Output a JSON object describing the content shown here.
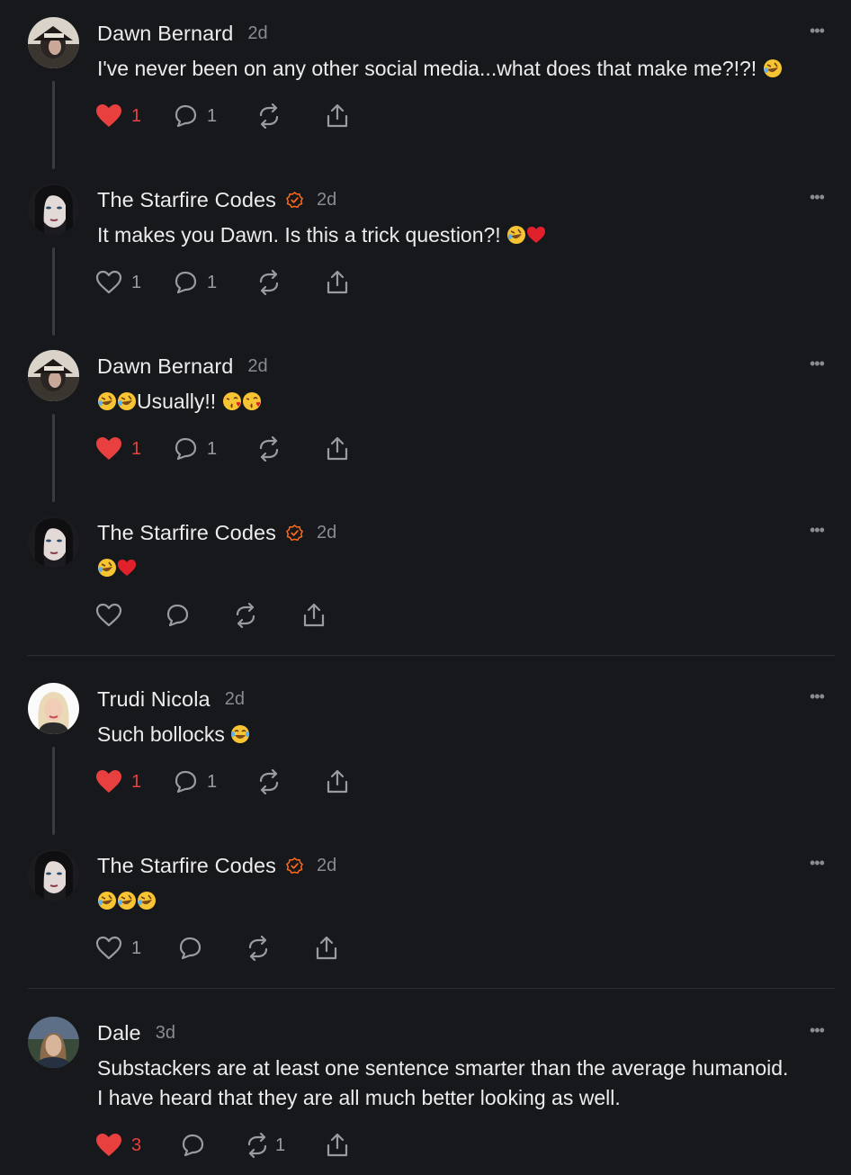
{
  "colors": {
    "background": "#17181b",
    "text": "#ececec",
    "muted": "#8a8b90",
    "like_red": "#e8403f",
    "verified_orange": "#ff6719",
    "thread_line": "#3a3b3f"
  },
  "comments": [
    {
      "author": "Dawn Bernard",
      "time": "2d",
      "verified": false,
      "text": "I've never been on any other social media...what does that make me?!?! ",
      "emoji": [
        "rofl"
      ],
      "liked": true,
      "likes": "1",
      "replies": "1",
      "restacks": "",
      "thread_line": true
    },
    {
      "author": "The Starfire Codes",
      "time": "2d",
      "verified": true,
      "text": "It makes you Dawn. Is this a trick question?! ",
      "emoji": [
        "rofl",
        "heart"
      ],
      "liked": false,
      "likes": "1",
      "replies": "1",
      "restacks": "",
      "thread_line": true
    },
    {
      "author": "Dawn Bernard",
      "time": "2d",
      "verified": false,
      "text_parts": [
        "Usually!! "
      ],
      "emoji_before": [
        "rofl",
        "rofl"
      ],
      "emoji_after": [
        "kiss",
        "kiss"
      ],
      "liked": true,
      "likes": "1",
      "replies": "1",
      "restacks": "",
      "thread_line": true
    },
    {
      "author": "The Starfire Codes",
      "time": "2d",
      "verified": true,
      "text": "",
      "emoji": [
        "rofl",
        "heart"
      ],
      "liked": false,
      "likes": "",
      "replies": "",
      "restacks": "",
      "thread_line": false
    },
    {
      "author": "Trudi Nicola",
      "time": "2d",
      "verified": false,
      "text": "Such bollocks ",
      "emoji": [
        "joy"
      ],
      "liked": true,
      "likes": "1",
      "replies": "1",
      "restacks": "",
      "thread_line": true
    },
    {
      "author": "The Starfire Codes",
      "time": "2d",
      "verified": true,
      "text": "",
      "emoji": [
        "rofl",
        "rofl",
        "rofl"
      ],
      "liked": false,
      "likes": "1",
      "replies": "",
      "restacks": "",
      "thread_line": false
    },
    {
      "author": "Dale",
      "time": "3d",
      "verified": false,
      "text_lines": [
        "Substackers are at least one sentence smarter than the average humanoid.",
        "I have heard that they are all much better looking as well."
      ],
      "liked": true,
      "likes": "3",
      "replies": "",
      "restacks": "1",
      "thread_line": false
    }
  ],
  "more_label": "•••",
  "icons": {
    "like": "heart-icon",
    "reply": "comment-bubble-icon",
    "restack": "restack-arrows-icon",
    "share": "share-upload-icon",
    "more": "more-dots-icon",
    "verified": "verified-badge-icon"
  }
}
